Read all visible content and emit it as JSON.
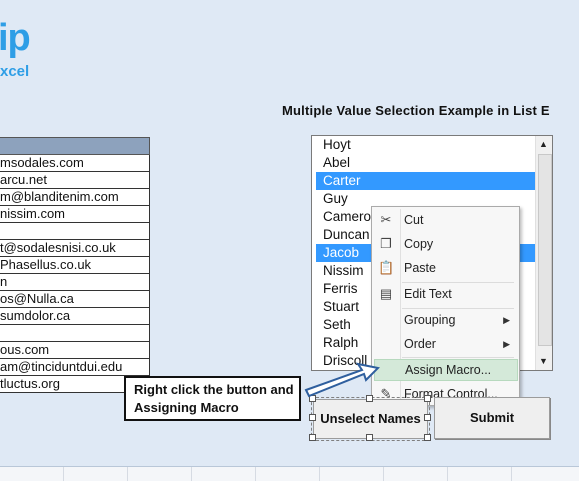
{
  "logo": {
    "big": "ip",
    "small": "xcel"
  },
  "heading": "Multiple Value Selection Example in List E",
  "table": {
    "rows": [
      "msodales.com",
      "arcu.net",
      "m@blanditenim.com",
      "nissim.com",
      "",
      "t@sodalesnisi.co.uk",
      "Phasellus.co.uk",
      "n",
      "os@Nulla.ca",
      "sumdolor.ca",
      "",
      "ous.com",
      "am@tinciduntdui.edu",
      "tluctus.org"
    ]
  },
  "listbox": {
    "items": [
      {
        "label": "Hoyt",
        "selected": false
      },
      {
        "label": "Abel",
        "selected": false
      },
      {
        "label": "Carter",
        "selected": true
      },
      {
        "label": "Guy",
        "selected": false
      },
      {
        "label": "Camero",
        "selected": false
      },
      {
        "label": "Duncan",
        "selected": false
      },
      {
        "label": "Jacob",
        "selected": true
      },
      {
        "label": "Nissim",
        "selected": false
      },
      {
        "label": "Ferris",
        "selected": false
      },
      {
        "label": "Stuart",
        "selected": false
      },
      {
        "label": "Seth",
        "selected": false
      },
      {
        "label": "Ralph",
        "selected": false
      },
      {
        "label": "Driscoll",
        "selected": false
      }
    ],
    "selection_color": "#3399ff"
  },
  "context_menu": {
    "cut": "Cut",
    "copy": "Copy",
    "paste": "Paste",
    "edit_text": "Edit Text",
    "grouping": "Grouping",
    "order": "Order",
    "assign_macro": "Assign Macro...",
    "format_control": "Format Control..."
  },
  "buttons": {
    "unselect": "Unselect Names",
    "submit": "Submit"
  },
  "callout": {
    "line1": "Right click the button and",
    "line2": "Assigning Macro"
  },
  "colors": {
    "sheet_bg": "#dfe9f5",
    "logo": "#2e9ee6",
    "header_fill": "#8da2bd",
    "menu_highlight": "#d4e9d9"
  }
}
